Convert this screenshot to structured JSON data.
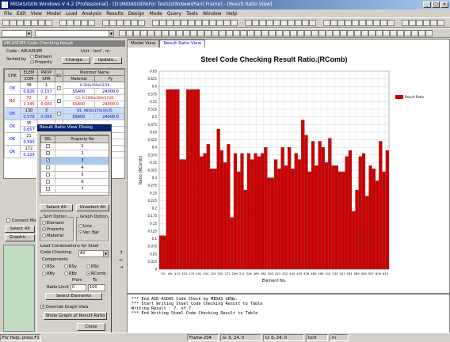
{
  "window": {
    "title": "MIDAS/GEN Windows V 4.2 [Professional] - [D:\\MIDASGEN\\For Test\\GEN\\New\\Plant Frame] - [Result Ratio View]"
  },
  "menu": [
    "File",
    "Edit",
    "View",
    "Model",
    "Load",
    "Analysis",
    "Results",
    "Design",
    "Mode",
    "Query",
    "Tools",
    "Window",
    "Help"
  ],
  "left_panel": {
    "tree_title": "AIK-ASD85 Code Checking Result",
    "code_label": "Code : AIK-ASD85",
    "unit_label": "Unit : tonf , m",
    "sorted_by": "Sorted by",
    "sort_element": "Element",
    "sort_property": "Property",
    "change_btn": "Change...",
    "update_btn": "Update...",
    "headers": {
      "chk": "CHK",
      "elem": "ELEM",
      "prop": "PROP",
      "sel": "SEL",
      "member": "Member Name",
      "com": "COM",
      "shr": "SHR",
      "material": "Material",
      "fy": "Fy"
    },
    "rows": [
      {
        "chk": "OK",
        "elem": "38",
        "prop": "1",
        "name": "H 350x350x12/19",
        "com": "0.826",
        "shr": "0.157",
        "mat": "SS400",
        "fy": "24000.0",
        "color": "#000"
      },
      {
        "chk": "NG",
        "elem": "72",
        "prop": "2",
        "name": "C2, H 2000x300x17/25",
        "com": "1.345",
        "shr": "0.000",
        "mat": "SS400",
        "fy": "24000.0",
        "color": "#c00000"
      },
      {
        "chk": "OK",
        "elem": "130",
        "prop": "3",
        "name": "B1, H600x150x16/35",
        "com": "0.576",
        "shr": "0.000",
        "mat": "SS400",
        "fy": "24000.0",
        "color": "#000"
      },
      {
        "chk": "OK",
        "elem": "35",
        "prop": "",
        "name": "",
        "com": "0.657",
        "shr": "",
        "mat": "",
        "fy": "",
        "color": "#000"
      },
      {
        "chk": "OK",
        "elem": "21",
        "prop": "",
        "name": "",
        "com": "0.590",
        "shr": "",
        "mat": "",
        "fy": "",
        "color": "#000"
      },
      {
        "chk": "OK",
        "elem": "172",
        "prop": "",
        "name": "",
        "com": "0.229",
        "shr": "",
        "mat": "",
        "fy": "",
        "color": "#000"
      }
    ],
    "connect_model": "Connect Model",
    "select_all": "Select All",
    "graphic_btn": "Graphic..."
  },
  "dialog": {
    "title": "Result Ratio View Dialog",
    "col_sel": "SEL",
    "col_property": "Property No",
    "properties": [
      "1",
      "2",
      "3",
      "4",
      "5",
      "6",
      "7"
    ],
    "checked_index": 2,
    "select_all": "Select All",
    "unselect_all": "Unselect All",
    "sort_option": "Sort Option",
    "sort_items": [
      "Element",
      "Property",
      "Material"
    ],
    "graph_option": "Graph Option",
    "graph_items": [
      "Line",
      "Ver. Bar"
    ],
    "load_comb": "Load Combinations for Steel",
    "code_checking": "Code Checking",
    "code_value": "All",
    "components": "Components",
    "comp_items": [
      "RSx",
      "RSy",
      "RSz",
      "RBy",
      "RBz",
      "RComb"
    ],
    "from_label": "From",
    "to_label": "To",
    "ratio_limit": "Ratio Limit",
    "ratio_from": "0",
    "ratio_to": "100",
    "select_elements": "Select Elements",
    "override": "Override Graph View",
    "show_graph": "Show Graph of Result Ratio",
    "close": "Close"
  },
  "tabs": [
    "Model View",
    "Result Ratio View"
  ],
  "chart_data": {
    "type": "bar",
    "title": "Steel Code Checking Result Ratio.(RComb)",
    "xlabel": "Element No.",
    "ylabel": "Ratio (RComb)",
    "legend": "Result Ratio",
    "legend_position": "top-right",
    "ylim": [
      0,
      0.65
    ],
    "yticks": [
      "0",
      "0.025",
      "0.05",
      "0.075",
      "0.1",
      "0.125",
      "0.15",
      "0.175",
      "0.2",
      "0.225",
      "0.25",
      "0.275",
      "0.3",
      "0.325",
      "0.35",
      "0.375",
      "0.4",
      "0.425",
      "0.45",
      "0.475",
      "0.5",
      "0.525",
      "0.55",
      "0.575",
      "0.6",
      "0.625",
      "0.65"
    ],
    "xticks": [
      "33",
      "69",
      "113",
      "151",
      "170",
      "191",
      "204",
      "225",
      "250",
      "271",
      "296",
      "311",
      "349",
      "369",
      "382",
      "393",
      "421",
      "432",
      "444",
      "455",
      "476",
      "480",
      "496",
      "512",
      "535",
      "547",
      "561",
      "569",
      "583",
      "597",
      "609",
      "615"
    ],
    "values": [
      0.11,
      0.11,
      0.59,
      0.59,
      0.59,
      0.59,
      0.36,
      0.36,
      0.59,
      0.59,
      0.59,
      0.59,
      0.37,
      0.38,
      0.41,
      0.33,
      0.33,
      0.46,
      0.39,
      0.35,
      0.41,
      0.17,
      0.38,
      0.32,
      0.38,
      0.26,
      0.38,
      0.36,
      0.38,
      0.37,
      0.38,
      0.4,
      0.3,
      0.3,
      0.36,
      0.33,
      0.4,
      0.34,
      0.4,
      0.33,
      0.38,
      0.36,
      0.49,
      0.44,
      0.32,
      0.42,
      0.34,
      0.42,
      0.4,
      0.35,
      0.43,
      0.34,
      0.34,
      0.32,
      0.32,
      0.37,
      0.39,
      0.19,
      0.26,
      0.37,
      0.38,
      0.24,
      0.34,
      0.33,
      0.29,
      0.42,
      0.32,
      0.39
    ],
    "bar_color": "#cc0000",
    "grid": true
  },
  "output": [
    "*** End AIK-ASD85 Code Check by MIDAS GENw.",
    "*** Start Writing Steel Code Checking Result to Table",
    "     Writing Result :     7, of     7.",
    "*** End Writing Steel Code Checking Result to Table"
  ],
  "status": {
    "help": "For Help, press F1",
    "frame": "Frame-204",
    "coord1": "G: 0, 24, 0",
    "coord2": "U: 0, 24, 0",
    "unit1": "tonf",
    "unit2": "m"
  }
}
